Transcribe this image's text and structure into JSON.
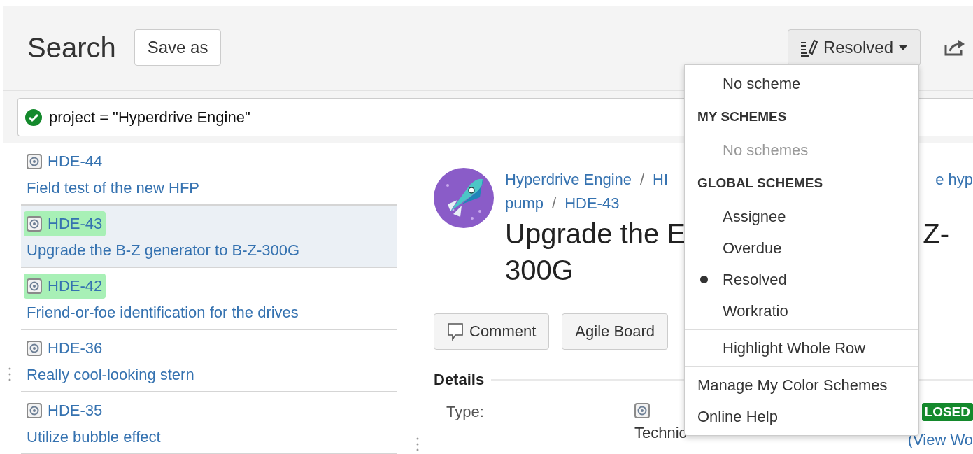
{
  "header": {
    "title": "Search",
    "save_button": "Save as",
    "scheme_button": "Resolved"
  },
  "query": {
    "value": "project = \"Hyperdrive Engine\"",
    "valid": true
  },
  "issues": [
    {
      "key": "HDE-44",
      "summary": "Field test of the new HFP",
      "selected": false
    },
    {
      "key": "HDE-43",
      "summary": "Upgrade the B-Z generator to B-Z-300G",
      "selected": true,
      "color": "#a8f0b6"
    },
    {
      "key": "HDE-42",
      "summary": "Friend-or-foe identification for the drives",
      "selected": false,
      "color": "#a8f0b6"
    },
    {
      "key": "HDE-36",
      "summary": "Really cool-looking stern",
      "selected": false
    },
    {
      "key": "HDE-35",
      "summary": "Utilize bubble effect",
      "selected": false
    }
  ],
  "detail": {
    "breadcrumb_line_1": [
      "Hyperdrive Engine",
      "HI"
    ],
    "breadcrumb_line_1_right": "e hyp",
    "breadcrumb_line_2": [
      "pump",
      "HDE-43"
    ],
    "breadcrumb_separator": "/",
    "title_line_1": "Upgrade the E",
    "title_line_1_right": "Z-",
    "title_line_2": "300G",
    "buttons": [
      {
        "label": "Comment",
        "kind": "comment"
      },
      {
        "label": "Agile Board",
        "kind": "plain"
      }
    ],
    "section_title": "Details",
    "fields": [
      {
        "label": "Type:",
        "value": "Technic",
        "status": "LOSED",
        "link": "(View Wo"
      }
    ]
  },
  "scheme_menu": {
    "sections": [
      {
        "items": [
          {
            "label": "No scheme",
            "selected": false
          }
        ]
      },
      {
        "heading": "MY SCHEMES",
        "empty": "No schemes"
      },
      {
        "heading": "GLOBAL SCHEMES",
        "items": [
          {
            "label": "Assignee",
            "selected": false
          },
          {
            "label": "Overdue",
            "selected": false
          },
          {
            "label": "Resolved",
            "selected": true
          },
          {
            "label": "Workratio",
            "selected": false
          }
        ]
      }
    ],
    "option": {
      "label": "Highlight Whole Row",
      "checked": false
    },
    "links": [
      "Manage My Color Schemes",
      "Online Help"
    ]
  }
}
